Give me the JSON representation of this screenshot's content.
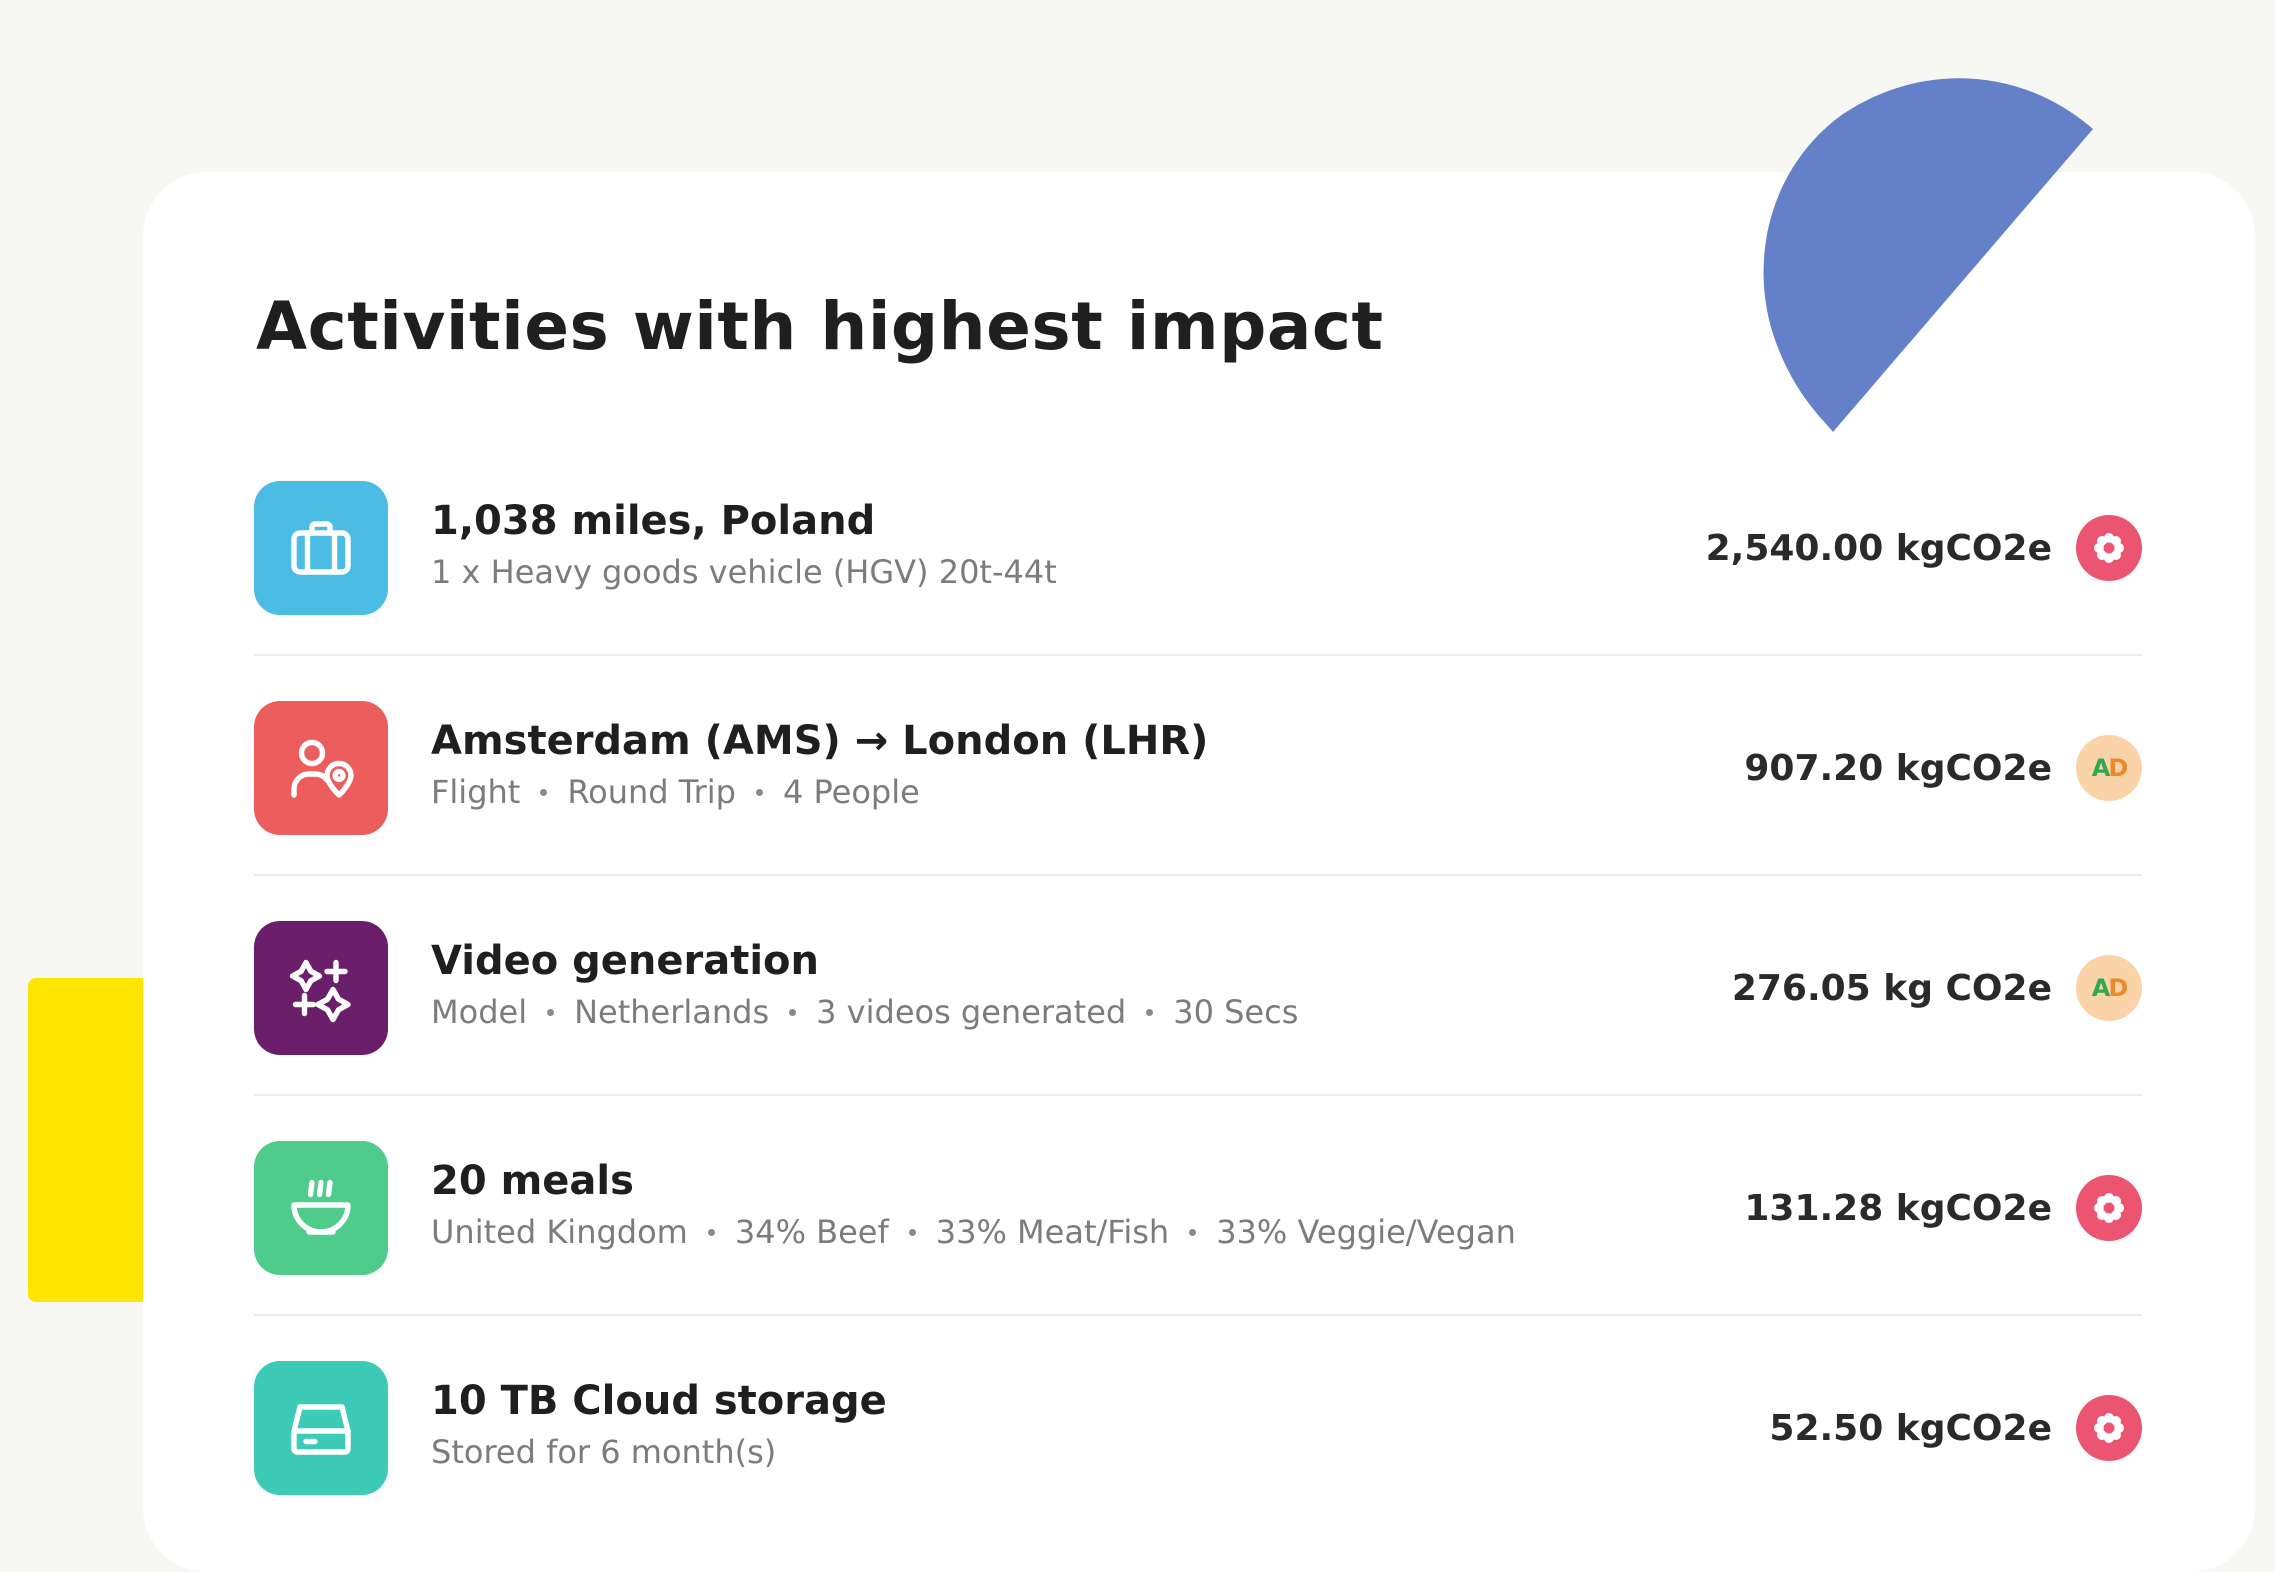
{
  "card": {
    "title": "Activities with highest impact"
  },
  "colors": {
    "background": "#f7f7f4",
    "card": "#ffffff",
    "accent_blue": "#6380c9",
    "accent_yellow": "#ffe600",
    "badge_red": "#ec5571",
    "badge_peach": "#fbd3a8"
  },
  "activities": [
    {
      "icon": "suitcase-icon",
      "icon_color": "#4bbde5",
      "title": "1,038 miles, Poland",
      "details": [
        "1 x Heavy goods vehicle (HGV) 20t-44t"
      ],
      "value": "2,540.00 kgCO2e",
      "badge": "flower-icon"
    },
    {
      "icon": "people-location-icon",
      "icon_color": "#ec5d5d",
      "title": "Amsterdam (AMS) → London (LHR)",
      "details": [
        "Flight",
        "Round Trip",
        "4 People"
      ],
      "value": "907.20 kgCO2e",
      "badge": "ad-logo-icon",
      "badge_text": "AD"
    },
    {
      "icon": "sparkles-icon",
      "icon_color": "#6b1f6b",
      "title": "Video generation",
      "details": [
        "Model",
        "Netherlands",
        "3 videos generated",
        "30 Secs"
      ],
      "value": "276.05 kg CO2e",
      "badge": "ad-logo-icon",
      "badge_text": "AD"
    },
    {
      "icon": "bowl-icon",
      "icon_color": "#4fcb8c",
      "title": "20 meals",
      "details": [
        "United Kingdom",
        "34% Beef",
        "33% Meat/Fish",
        "33% Veggie/Vegan"
      ],
      "value": "131.28 kgCO2e",
      "badge": "flower-icon"
    },
    {
      "icon": "storage-drive-icon",
      "icon_color": "#3dcbb8",
      "title": "10 TB Cloud storage",
      "details": [
        "Stored for 6 month(s)"
      ],
      "value": "52.50 kgCO2e",
      "badge": "flower-icon"
    }
  ]
}
